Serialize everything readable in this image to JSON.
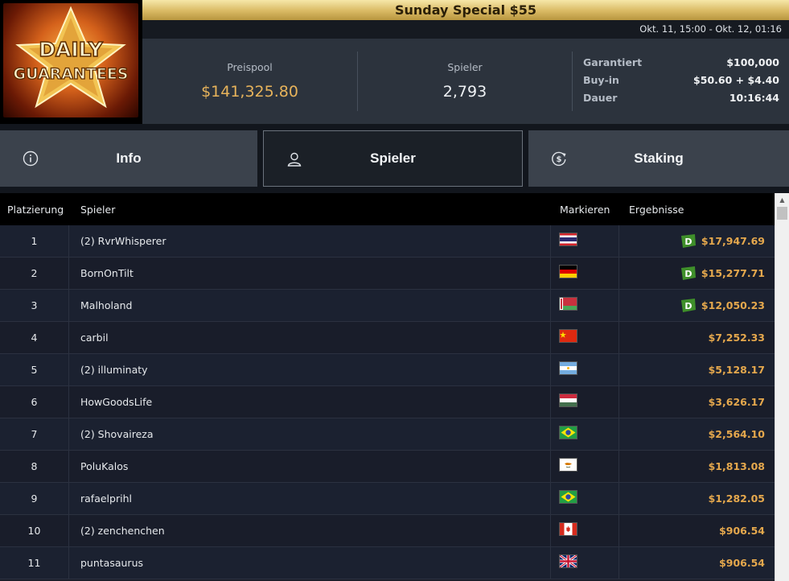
{
  "logo": {
    "line1": "DAILY",
    "line2": "GUARANTEES"
  },
  "title": "Sunday Special $55",
  "date_range": "Okt. 11, 15:00 - Okt. 12, 01:16",
  "stats": {
    "prize_label": "Preispool",
    "prize_value": "$141,325.80",
    "players_label": "Spieler",
    "players_value": "2,793"
  },
  "details": [
    {
      "key": "Garantiert",
      "value": "$100,000"
    },
    {
      "key": "Buy-in",
      "value": "$50.60 + $4.40"
    },
    {
      "key": "Dauer",
      "value": "10:16:44"
    }
  ],
  "tabs": [
    {
      "label": "Info",
      "icon": "info-icon"
    },
    {
      "label": "Spieler",
      "icon": "person-icon"
    },
    {
      "label": "Staking",
      "icon": "dollar-cycle-icon"
    }
  ],
  "table": {
    "headers": {
      "rank": "Platzierung",
      "player": "Spieler",
      "flag": "Markieren",
      "result": "Ergebnisse"
    },
    "rows": [
      {
        "rank": "1",
        "player": "(2) RvrWhisperer",
        "flag": "thailand-flag-icon",
        "result": "$17,947.69",
        "badge": true
      },
      {
        "rank": "2",
        "player": "BornOnTilt",
        "flag": "germany-flag-icon",
        "result": "$15,277.71",
        "badge": true
      },
      {
        "rank": "3",
        "player": "Malholand",
        "flag": "belarus-flag-icon",
        "result": "$12,050.23",
        "badge": true
      },
      {
        "rank": "4",
        "player": "carbil",
        "flag": "china-flag-icon",
        "result": "$7,252.33",
        "badge": false
      },
      {
        "rank": "5",
        "player": "(2) illuminaty",
        "flag": "argentina-flag-icon",
        "result": "$5,128.17",
        "badge": false
      },
      {
        "rank": "6",
        "player": "HowGoodsLife",
        "flag": "hungary-flag-icon",
        "result": "$3,626.17",
        "badge": false
      },
      {
        "rank": "7",
        "player": "(2) Shovaireza",
        "flag": "brazil-flag-icon",
        "result": "$2,564.10",
        "badge": false
      },
      {
        "rank": "8",
        "player": "PoluKalos",
        "flag": "cyprus-flag-icon",
        "result": "$1,813.08",
        "badge": false
      },
      {
        "rank": "9",
        "player": "rafaelprihl",
        "flag": "brazil-flag-icon",
        "result": "$1,282.05",
        "badge": false
      },
      {
        "rank": "10",
        "player": "(2) zenchenchen",
        "flag": "canada-flag-icon",
        "result": "$906.54",
        "badge": false
      },
      {
        "rank": "11",
        "player": "puntasaurus",
        "flag": "uk-flag-icon",
        "result": "$906.54",
        "badge": false
      }
    ]
  },
  "colors": {
    "accent_gold": "#e7b35b",
    "result_orange": "#e5a84d",
    "badge_green": "#3f8f2a"
  }
}
